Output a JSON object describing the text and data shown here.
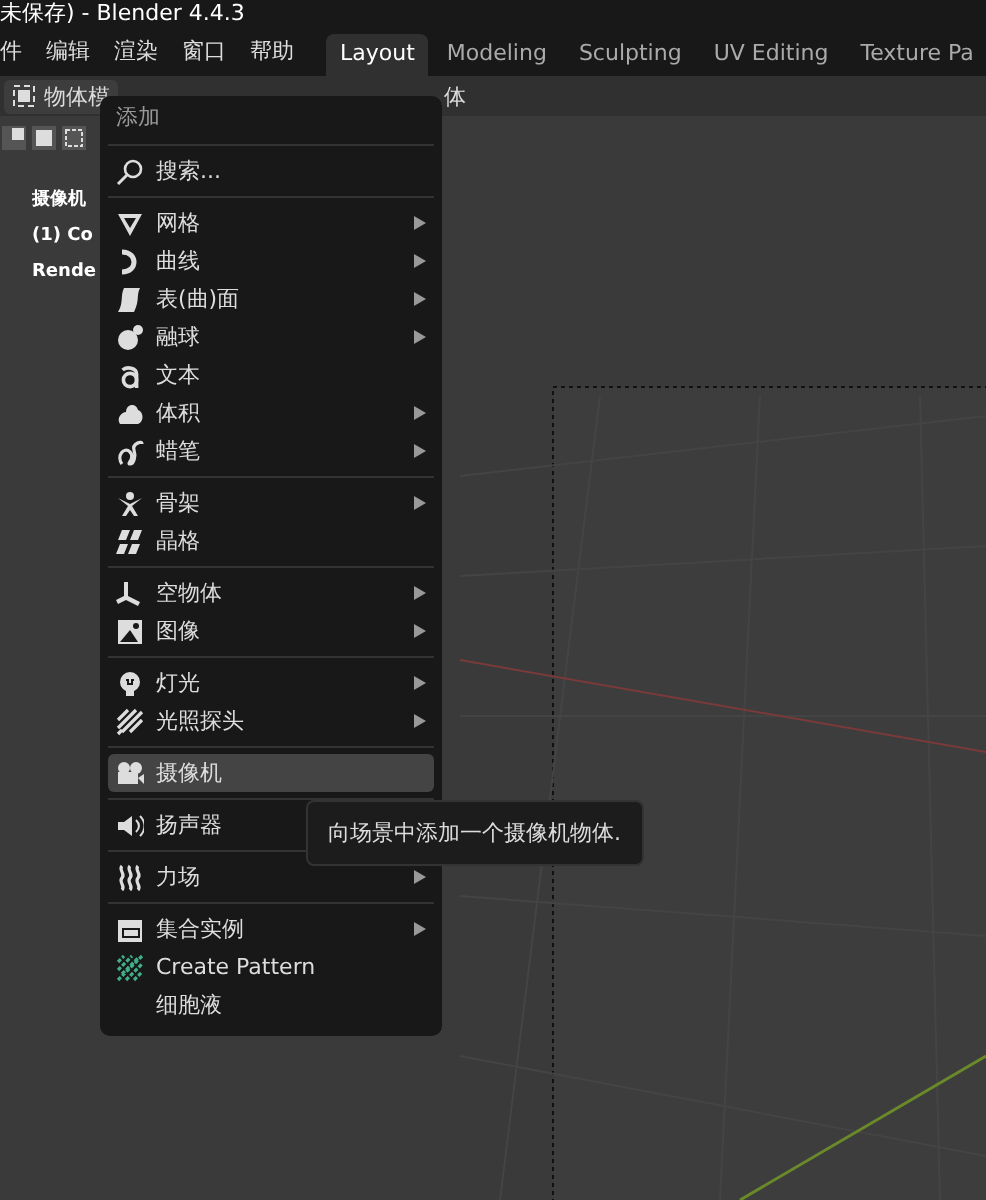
{
  "window": {
    "title": "未保存) - Blender 4.4.3"
  },
  "menubar": {
    "items": [
      "件",
      "编辑",
      "渲染",
      "窗口",
      "帮助"
    ]
  },
  "workspace_tabs": [
    {
      "label": "Layout",
      "selected": true
    },
    {
      "label": "Modeling",
      "selected": false
    },
    {
      "label": "Sculpting",
      "selected": false
    },
    {
      "label": "UV Editing",
      "selected": false
    },
    {
      "label": "Texture Pa",
      "selected": false
    }
  ],
  "viewport_header": {
    "mode": "物体模",
    "menu_fragment": "体"
  },
  "viewport_overlay": [
    "摄像机",
    "(1) Co",
    "Rende"
  ],
  "add_menu": {
    "title": "添加",
    "search": "搜索...",
    "sections": [
      [
        {
          "label": "网格",
          "submenu": true,
          "selected": false
        },
        {
          "label": "曲线",
          "submenu": true,
          "selected": false
        },
        {
          "label": "表(曲)面",
          "submenu": true,
          "selected": false
        },
        {
          "label": "融球",
          "submenu": true,
          "selected": false
        },
        {
          "label": "文本",
          "submenu": false,
          "selected": false
        },
        {
          "label": "体积",
          "submenu": true,
          "selected": false
        },
        {
          "label": "蜡笔",
          "submenu": true,
          "selected": false
        }
      ],
      [
        {
          "label": "骨架",
          "submenu": true,
          "selected": false
        },
        {
          "label": "晶格",
          "submenu": false,
          "selected": false
        }
      ],
      [
        {
          "label": "空物体",
          "submenu": true,
          "selected": false
        },
        {
          "label": "图像",
          "submenu": true,
          "selected": false
        }
      ],
      [
        {
          "label": "灯光",
          "submenu": true,
          "selected": false
        },
        {
          "label": "光照探头",
          "submenu": true,
          "selected": false
        }
      ],
      [
        {
          "label": "摄像机",
          "submenu": false,
          "selected": true
        }
      ],
      [
        {
          "label": "扬声器",
          "submenu": false,
          "selected": false
        }
      ],
      [
        {
          "label": "力场",
          "submenu": true,
          "selected": false
        }
      ],
      [
        {
          "label": "集合实例",
          "submenu": true,
          "selected": false
        },
        {
          "label": "Create Pattern",
          "submenu": false,
          "selected": false
        },
        {
          "label": "细胞液",
          "submenu": false,
          "selected": false
        }
      ]
    ]
  },
  "tooltip": "向场景中添加一个摄像机物体."
}
